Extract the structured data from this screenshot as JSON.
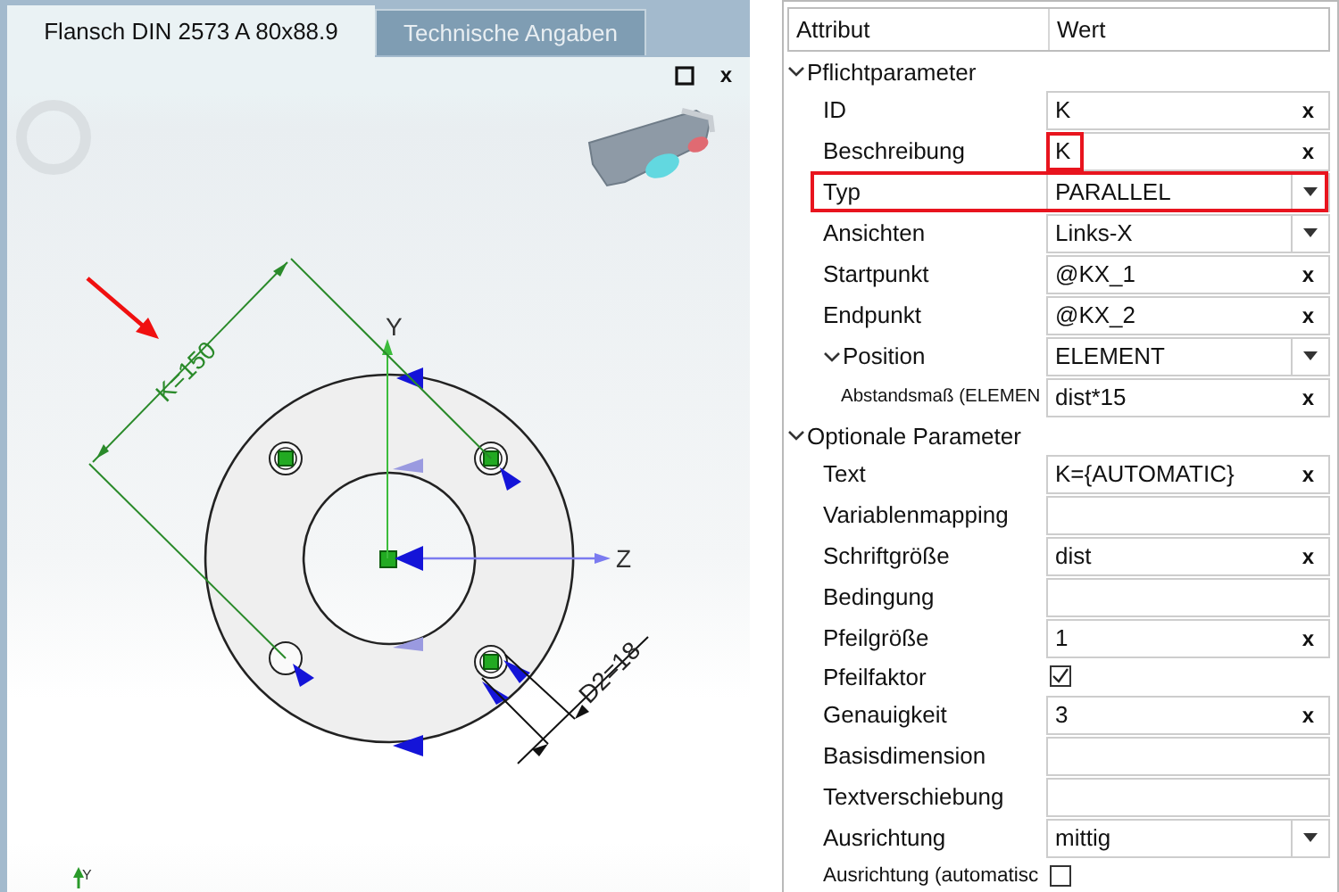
{
  "document_tabs": [
    {
      "label": "Flansch DIN 2573 A 80x88.9",
      "selected": true
    },
    {
      "label": "Technische Angaben",
      "selected": false
    }
  ],
  "viewport": {
    "close": "x",
    "dimension_k": "K=150",
    "axis_y": "Y",
    "axis_z": "Z",
    "dimension_d2": "D2=18",
    "corner_axis": "Y"
  },
  "properties": {
    "columns": [
      "Attribut",
      "Wert"
    ],
    "groups": [
      {
        "label": "Pflichtparameter",
        "expanded": true,
        "rows": [
          {
            "label": "ID",
            "kind": "text",
            "value": "K",
            "clear": "x",
            "highlighted": false,
            "value_highlighted": false
          },
          {
            "label": "Beschreibung",
            "kind": "text",
            "value": "K",
            "clear": "x",
            "highlighted": false,
            "value_highlighted": true
          },
          {
            "label": "Typ",
            "kind": "dropdown",
            "value": "PARALLEL",
            "highlighted": true,
            "value_highlighted": false
          },
          {
            "label": "Ansichten",
            "kind": "dropdown",
            "value": "Links-X",
            "highlighted": false,
            "value_highlighted": false
          },
          {
            "label": "Startpunkt",
            "kind": "text",
            "value": "@KX_1",
            "clear": "x",
            "highlighted": false,
            "value_highlighted": false
          },
          {
            "label": "Endpunkt",
            "kind": "text",
            "value": "@KX_2",
            "clear": "x",
            "highlighted": false,
            "value_highlighted": false
          },
          {
            "label": "Position",
            "kind": "dropdown",
            "value": "ELEMENT",
            "highlighted": false,
            "value_highlighted": false,
            "expanded": true,
            "children": [
              {
                "label": "Abstandsmaß (ELEMEN",
                "kind": "text",
                "value": "dist*15",
                "clear": "x",
                "highlighted": false,
                "value_highlighted": false
              }
            ]
          }
        ]
      },
      {
        "label": "Optionale Parameter",
        "expanded": true,
        "rows": [
          {
            "label": "Text",
            "kind": "text",
            "value": "K={AUTOMATIC}",
            "clear": "x",
            "highlighted": false,
            "value_highlighted": false
          },
          {
            "label": "Variablenmapping",
            "kind": "text",
            "highlighted": false,
            "value_highlighted": false
          },
          {
            "label": "Schriftgröße",
            "kind": "text",
            "value": "dist",
            "clear": "x",
            "highlighted": false,
            "value_highlighted": false
          },
          {
            "label": "Bedingung",
            "kind": "text",
            "highlighted": false,
            "value_highlighted": false
          },
          {
            "label": "Pfeilgröße",
            "kind": "text",
            "value": "1",
            "clear": "x",
            "highlighted": false,
            "value_highlighted": false
          },
          {
            "label": "Pfeilfaktor",
            "kind": "checkbox",
            "checked": true,
            "highlighted": false,
            "value_highlighted": false
          },
          {
            "label": "Genauigkeit",
            "kind": "text",
            "value": "3",
            "clear": "x",
            "highlighted": false,
            "value_highlighted": false
          },
          {
            "label": "Basisdimension",
            "kind": "text",
            "highlighted": false,
            "value_highlighted": false
          },
          {
            "label": "Textverschiebung",
            "kind": "text",
            "highlighted": false,
            "value_highlighted": false
          },
          {
            "label": "Ausrichtung",
            "kind": "dropdown",
            "value": "mittig",
            "highlighted": false,
            "value_highlighted": false
          },
          {
            "label": "Ausrichtung (automatisc",
            "kind": "checkbox",
            "checked": false,
            "highlighted": false,
            "value_highlighted": false
          }
        ]
      }
    ]
  }
}
